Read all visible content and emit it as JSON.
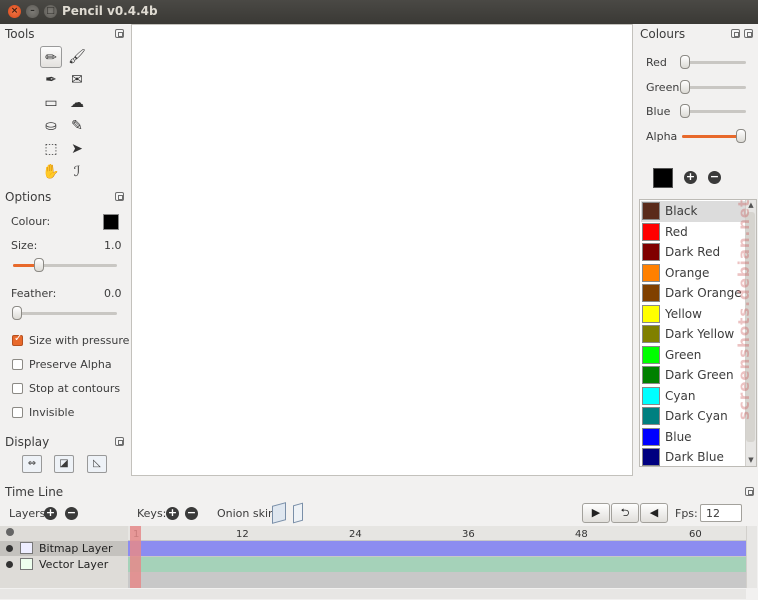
{
  "window": {
    "title": "Pencil v0.4.4b",
    "close": "×",
    "min": "–",
    "max": "□"
  },
  "tools_panel": {
    "title": "Tools",
    "tools": [
      {
        "name": "pencil",
        "glyph": "✏"
      },
      {
        "name": "brush",
        "glyph": "🖌"
      },
      {
        "name": "pen",
        "glyph": "✒"
      },
      {
        "name": "polyline",
        "glyph": "✉"
      },
      {
        "name": "eraser",
        "glyph": "▭"
      },
      {
        "name": "clear",
        "glyph": "☁"
      },
      {
        "name": "bucket",
        "glyph": "⛀"
      },
      {
        "name": "eyedropper",
        "glyph": "✎"
      },
      {
        "name": "select",
        "glyph": "⬚"
      },
      {
        "name": "move",
        "glyph": "➤"
      },
      {
        "name": "hand",
        "glyph": "✋"
      },
      {
        "name": "smudge",
        "glyph": "ℐ"
      }
    ]
  },
  "options_panel": {
    "title": "Options",
    "colour_label": "Colour:",
    "colour_value": "#000000",
    "size_label": "Size:",
    "size_value": "1.0",
    "feather_label": "Feather:",
    "feather_value": "0.0",
    "checkboxes": [
      {
        "label": "Size with pressure",
        "checked": true
      },
      {
        "label": "Preserve Alpha",
        "checked": false
      },
      {
        "label": "Stop at contours",
        "checked": false
      },
      {
        "label": "Invisible",
        "checked": false
      }
    ]
  },
  "display_panel": {
    "title": "Display"
  },
  "colours_panel": {
    "title": "Colours",
    "sliders": [
      {
        "label": "Red",
        "value": 0.0
      },
      {
        "label": "Green",
        "value": 0.0
      },
      {
        "label": "Blue",
        "value": 0.0
      },
      {
        "label": "Alpha",
        "value": 1.0
      }
    ],
    "current_colour": "#000000",
    "add": "+",
    "remove": "−",
    "palette": [
      {
        "name": "Black",
        "color": "#5a2a1a",
        "selected": true
      },
      {
        "name": "Red",
        "color": "#ff0000"
      },
      {
        "name": "Dark Red",
        "color": "#800000"
      },
      {
        "name": "Orange",
        "color": "#ff8000"
      },
      {
        "name": "Dark Orange",
        "color": "#804000"
      },
      {
        "name": "Yellow",
        "color": "#ffff00"
      },
      {
        "name": "Dark Yellow",
        "color": "#808000"
      },
      {
        "name": "Green",
        "color": "#00ff00"
      },
      {
        "name": "Dark Green",
        "color": "#008000"
      },
      {
        "name": "Cyan",
        "color": "#00ffff"
      },
      {
        "name": "Dark Cyan",
        "color": "#008080"
      },
      {
        "name": "Blue",
        "color": "#0000ff"
      },
      {
        "name": "Dark Blue",
        "color": "#000080"
      }
    ]
  },
  "timeline": {
    "title": "Time Line",
    "layers_label": "Layers:",
    "keys_label": "Keys:",
    "onion_label": "Onion skin:",
    "fps_label": "Fps:",
    "fps_value": "12",
    "ruler": [
      "1",
      "12",
      "24",
      "36",
      "48",
      "60"
    ],
    "layers": [
      {
        "name": "Bitmap Layer",
        "type": "bitmap",
        "color": "#8c8cf0"
      },
      {
        "name": "Vector Layer",
        "type": "vector",
        "color": "#a5d2b9"
      }
    ],
    "play": "▶",
    "loop": "⮌",
    "sound": "◀"
  },
  "watermark": "screenshots.debian.net"
}
